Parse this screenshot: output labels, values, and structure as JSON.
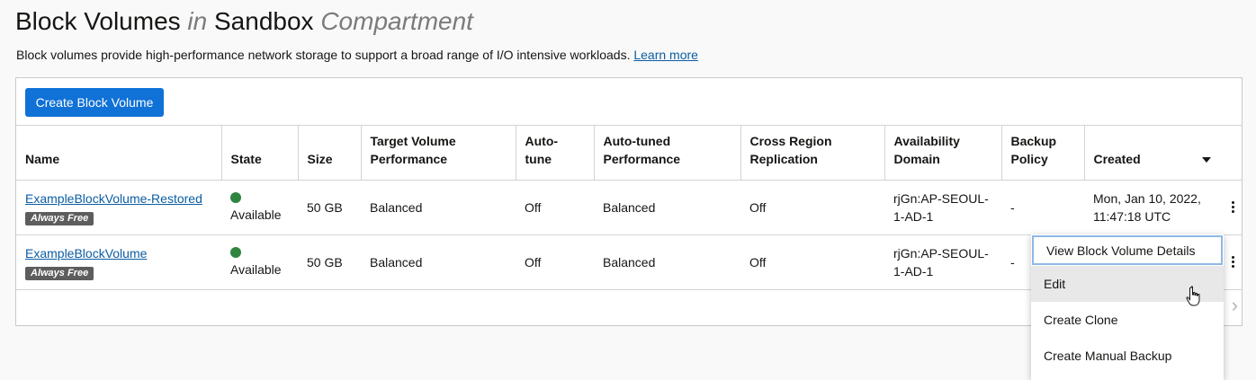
{
  "header": {
    "title_main": "Block Volumes",
    "title_in": "in",
    "title_compartment": "Sandbox",
    "title_suffix": "Compartment",
    "description": "Block volumes provide high-performance network storage to support a broad range of I/O intensive workloads.",
    "learn_more": "Learn more"
  },
  "toolbar": {
    "create_label": "Create Block Volume"
  },
  "table": {
    "columns": [
      "Name",
      "State",
      "Size",
      "Target Volume Performance",
      "Auto-tune",
      "Auto-tuned Performance",
      "Cross Region Replication",
      "Availability Domain",
      "Backup Policy",
      "Created"
    ],
    "rows": [
      {
        "name": "ExampleBlockVolume-Restored",
        "badge": "Always Free",
        "state": "Available",
        "size": "50 GB",
        "target_perf": "Balanced",
        "auto_tune": "Off",
        "auto_tuned_perf": "Balanced",
        "replication": "Off",
        "availability_domain": "rjGn:AP-SEOUL-1-AD-1",
        "backup_policy": "-",
        "created": "Mon, Jan 10, 2022, 11:47:18 UTC"
      },
      {
        "name": "ExampleBlockVolume",
        "badge": "Always Free",
        "state": "Available",
        "size": "50 GB",
        "target_perf": "Balanced",
        "auto_tune": "Off",
        "auto_tuned_perf": "Balanced",
        "replication": "Off",
        "availability_domain": "rjGn:AP-SEOUL-1-AD-1",
        "backup_policy": "-",
        "created": ""
      }
    ]
  },
  "menu": {
    "items": [
      "View Block Volume Details",
      "Edit",
      "Create Clone",
      "Create Manual Backup"
    ]
  },
  "colors": {
    "primary": "#1071d6",
    "link": "#0b5da3",
    "available": "#2e8540",
    "badge": "#5d5d5d"
  }
}
